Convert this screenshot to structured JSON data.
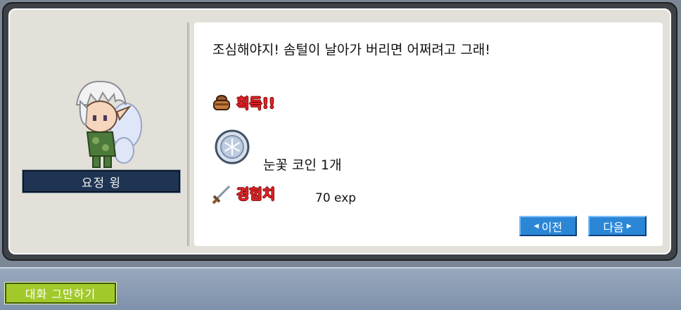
{
  "npc": {
    "name": "요정 윙"
  },
  "dialog": {
    "message": "조심해야지! 솜털이 날아가 버리면 어쩌려고 그래!",
    "acquire_label": "획득!!",
    "item": "눈꽃 코인 1개",
    "exp_label": "경험치",
    "exp_value": "70 exp"
  },
  "buttons": {
    "prev_label": "이전",
    "next_label": "다음",
    "end_chat_label": "대화 그만하기"
  },
  "icons": {
    "bag": "bag-icon",
    "coin": "snowflake-coin-icon",
    "exp": "sword-icon",
    "prev_arrow": "triangle-left-icon",
    "next_arrow": "triangle-right-icon"
  },
  "colors": {
    "accent_red": "#e4262c",
    "button_blue": "#2b86d6",
    "end_button_green": "#a2c92a",
    "nameplate": "#1f3452"
  }
}
